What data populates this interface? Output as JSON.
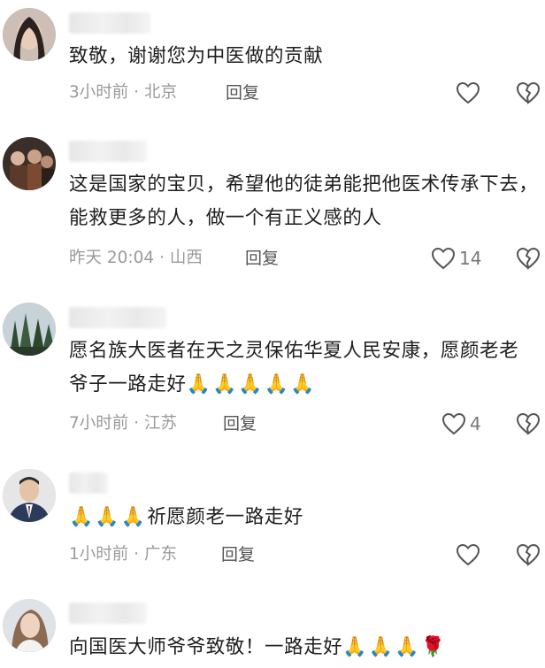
{
  "comments": [
    {
      "text": "致敬，谢谢您为中医做的贡献",
      "emoji": "",
      "time": "3小时前",
      "location": "北京",
      "reply_label": "回复",
      "likes": "",
      "avatar_icon": "woman-portrait-avatar"
    },
    {
      "text": "这是国家的宝贝，希望他的徒弟能把他医术传承下去，能救更多的人，做一个有正义感的人",
      "emoji": "",
      "time": "昨天 20:04",
      "location": "山西",
      "reply_label": "回复",
      "likes": "14",
      "avatar_icon": "group-photo-avatar"
    },
    {
      "text": "愿名族大医者在天之灵保佑华夏人民安康，愿颜老老爷子一路走好",
      "emoji": "🙏🙏🙏🙏🙏",
      "time": "7小时前",
      "location": "江苏",
      "reply_label": "回复",
      "likes": "4",
      "avatar_icon": "forest-avatar"
    },
    {
      "text": "祈愿颜老一路走好",
      "emoji_prefix": "🙏🙏🙏",
      "time": "1小时前",
      "location": "广东",
      "reply_label": "回复",
      "likes": "",
      "avatar_icon": "man-in-suit-avatar"
    },
    {
      "text": "向国医大师爷爷致敬！一路走好",
      "emoji": "🙏🙏🙏🌹",
      "avatar_icon": "woman-selfie-avatar"
    }
  ],
  "separator": " · ",
  "colors": {
    "text": "#1e1e1e",
    "meta": "#9a9a9a",
    "reply": "#555555",
    "icon": "#555555"
  }
}
